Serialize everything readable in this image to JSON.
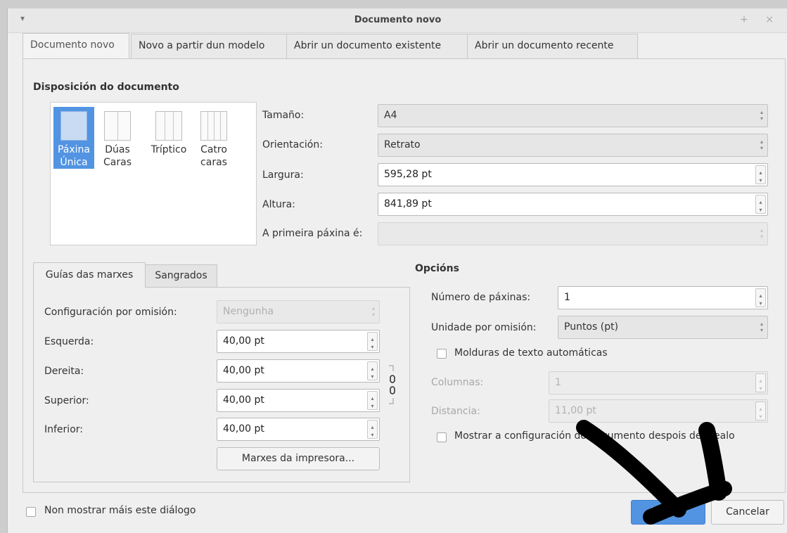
{
  "window": {
    "title": "Documento novo",
    "menu_icon": "▾",
    "controls": "+ ×"
  },
  "tabs": [
    "Documento novo",
    "Novo a partir dun modelo",
    "Abrir un documento existente",
    "Abrir un documento recente"
  ],
  "layout": {
    "title": "Disposición do documento",
    "options": [
      {
        "line1": "Páxina",
        "line2": "Única"
      },
      {
        "line1": "Dúas",
        "line2": "Caras"
      },
      {
        "line1": "Tríptico",
        "line2": ""
      },
      {
        "line1": "Catro",
        "line2": "caras"
      }
    ]
  },
  "page": {
    "size_label": "Tamaño:",
    "size_value": "A4",
    "orientation_label": "Orientación:",
    "orientation_value": "Retrato",
    "width_label": "Largura:",
    "width_value": "595,28 pt",
    "height_label": "Altura:",
    "height_value": "841,89 pt",
    "first_page_label": "A primeira páxina é:",
    "first_page_value": ""
  },
  "margins": {
    "tab_guides": "Guías das marxes",
    "tab_bleeds": "Sangrados",
    "preset_label": "Configuración por omisión:",
    "preset_value": "Nengunha",
    "left_label": "Esquerda:",
    "left_value": "40,00 pt",
    "right_label": "Dereita:",
    "right_value": "40,00 pt",
    "top_label": "Superior:",
    "top_value": "40,00 pt",
    "bottom_label": "Inferior:",
    "bottom_value": "40,00 pt",
    "printer_button": "Marxes da impresora..."
  },
  "options": {
    "title": "Opcións",
    "pages_label": "Número de páxinas:",
    "pages_value": "1",
    "unit_label": "Unidade por omisión:",
    "unit_value": "Puntos (pt)",
    "auto_frames_label": "Molduras de texto automáticas",
    "columns_label": "Columnas:",
    "columns_value": "1",
    "distance_label": "Distancia:",
    "distance_value": "11,00 pt",
    "show_settings_label": "Mostrar a configuración do documento despois de crealo"
  },
  "footer": {
    "dont_show_label": "Non mostrar máis este diálogo",
    "ok_button": "Aceptar",
    "cancel_button": "Cancelar"
  },
  "colors": {
    "accent": "#5294e2",
    "window_bg": "#efefef"
  }
}
